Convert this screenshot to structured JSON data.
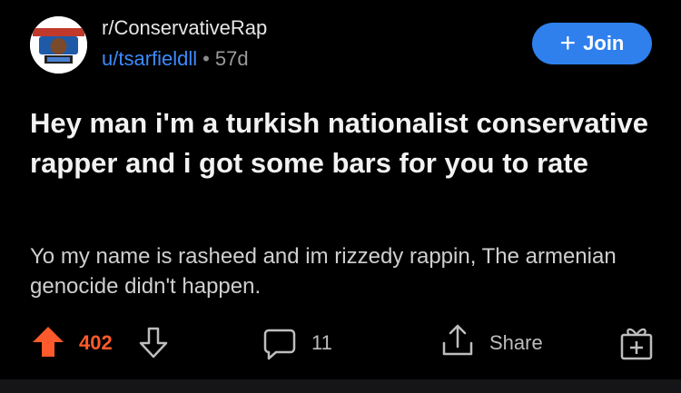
{
  "post": {
    "subreddit": "r/ConservativeRap",
    "author": "u/tsarfieldll",
    "separator": "•",
    "age": "57d",
    "join_label": "Join",
    "title": "Hey man i'm a turkish nationalist conservative rapper and i got some bars for you to rate",
    "body": "Yo my name is rasheed and im rizzedy rappin, The armenian genocide didn't happen."
  },
  "actions": {
    "score": "402",
    "comments": "11",
    "share_label": "Share"
  },
  "icons": {
    "avatar": "subreddit-avatar",
    "upvote": "upvote-arrow-icon",
    "downvote": "downvote-arrow-icon",
    "comment": "comment-bubble-icon",
    "share": "share-icon",
    "award": "award-gift-icon"
  },
  "colors": {
    "background": "#000000",
    "accent_blue": "#2f80ed",
    "username_blue": "#3d8bff",
    "upvote_orange": "#ff5a2b"
  }
}
